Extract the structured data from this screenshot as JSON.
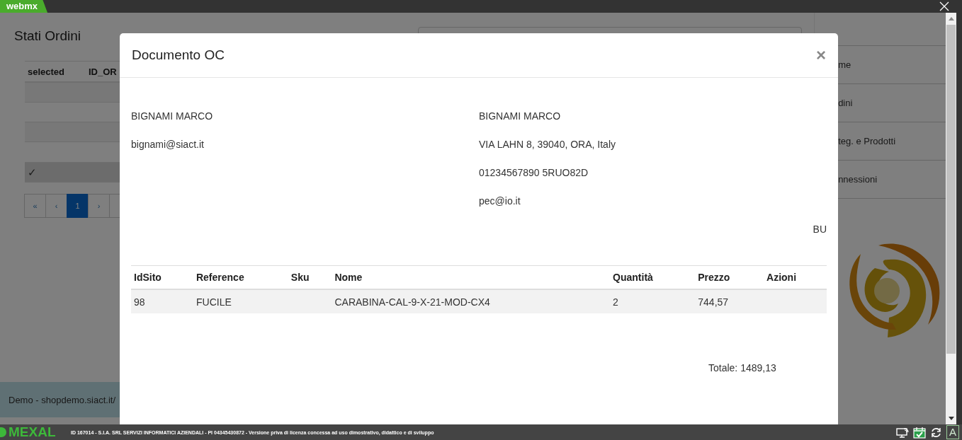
{
  "app_tab": "webmx",
  "page": {
    "title": "Stati Ordini",
    "table": {
      "columns": [
        "selected",
        "ID_OR"
      ],
      "rows": [
        {
          "selected": false
        },
        {
          "selected": false
        },
        {
          "selected": false
        },
        {
          "selected": false
        },
        {
          "selected": true,
          "check": "✓"
        }
      ]
    },
    "pagination": [
      {
        "label": "«",
        "selected": false
      },
      {
        "label": "‹",
        "selected": false
      },
      {
        "label": "1",
        "selected": true
      },
      {
        "label": "›",
        "selected": false
      }
    ],
    "footer": "Demo - shopdemo.siact.it/"
  },
  "sidebar": {
    "items": [
      "me",
      "dini",
      "teg. e Prodotti",
      "nnessioni"
    ]
  },
  "modal": {
    "title": "Documento OC",
    "close": "×",
    "billing": [
      "BIGNAMI MARCO",
      "bignami@siact.it"
    ],
    "shipping": [
      "BIGNAMI MARCO",
      "VIA LAHN 8, 39040, ORA, Italy",
      "01234567890 5RUO82D",
      "pec@io.it"
    ],
    "code": "BU",
    "table": {
      "columns": [
        "IdSito",
        "Reference",
        "Sku",
        "Nome",
        "Quantità",
        "Prezzo",
        "Azioni"
      ],
      "rows": [
        [
          "98",
          "FUCILE",
          "",
          "CARABINA-CAL-9-X-21-MOD-CX4",
          "2",
          "744,57",
          ""
        ]
      ]
    },
    "total": "Totale: 1489,13"
  },
  "status_bar": {
    "brand": "MEXAL",
    "info": "ID 167014 - S.I.A. SRL SERVIZI INFORMATICI AZIENDALI - PI 04345430872 - Versione priva di licenza concessa ad uso dimostrativo, didattico e di sviluppo",
    "key": "A"
  }
}
